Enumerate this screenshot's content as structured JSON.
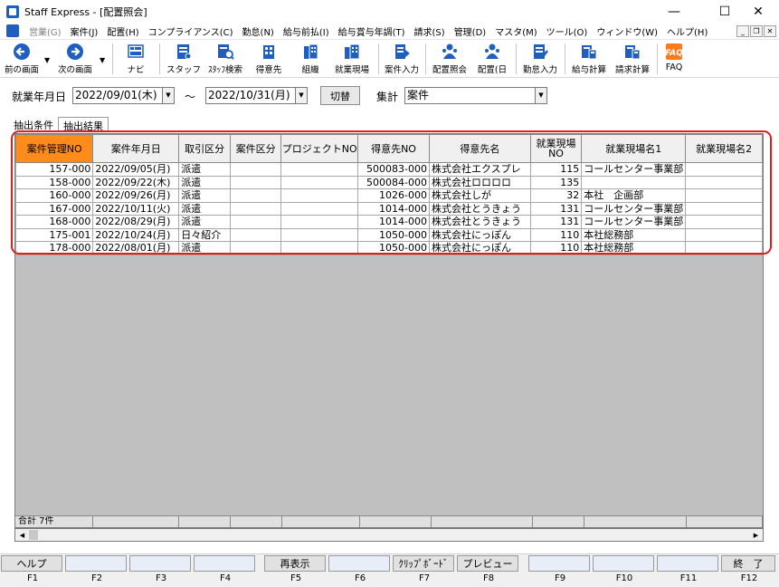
{
  "window": {
    "title": "Staff Express - [配置照会]",
    "controls": {
      "minimize": "—",
      "maximize": "☐",
      "close": "✕"
    }
  },
  "menubar": {
    "items": [
      {
        "label": "営業(G)",
        "disabled": true
      },
      {
        "label": "案件(J)"
      },
      {
        "label": "配置(H)"
      },
      {
        "label": "コンプライアンス(C)"
      },
      {
        "label": "勤怠(N)"
      },
      {
        "label": "給与前払(I)"
      },
      {
        "label": "給与賞与年調(T)"
      },
      {
        "label": "請求(S)"
      },
      {
        "label": "管理(D)"
      },
      {
        "label": "マスタ(M)"
      },
      {
        "label": "ツール(O)"
      },
      {
        "label": "ウィンドウ(W)"
      },
      {
        "label": "ヘルプ(H)"
      }
    ],
    "mdi_controls": {
      "minimize": "_",
      "restore": "❐",
      "close": "✕"
    }
  },
  "toolbar": {
    "buttons": [
      {
        "label": "前の画面",
        "icon": "arrow-left-icon"
      },
      {
        "label": "次の画面",
        "icon": "arrow-right-icon"
      },
      {
        "label": "ナビ",
        "icon": "navi-icon"
      },
      {
        "label": "スタッフ",
        "icon": "staff-icon"
      },
      {
        "label": "ｽﾀｯﾌ検索",
        "icon": "staff-search-icon"
      },
      {
        "label": "得意先",
        "icon": "customer-icon"
      },
      {
        "label": "組織",
        "icon": "organization-icon"
      },
      {
        "label": "就業現場",
        "icon": "worksite-icon"
      },
      {
        "label": "案件入力",
        "icon": "case-entry-icon"
      },
      {
        "label": "配置照会",
        "icon": "placement-inquiry-icon"
      },
      {
        "label": "配置(日",
        "icon": "placement-daily-icon"
      },
      {
        "label": "勤怠入力",
        "icon": "attendance-entry-icon"
      },
      {
        "label": "給与計算",
        "icon": "payroll-icon"
      },
      {
        "label": "請求計算",
        "icon": "billing-icon"
      },
      {
        "label": "FAQ",
        "icon": "faq-icon"
      }
    ]
  },
  "filter": {
    "date_label": "就業年月日",
    "date_from": "2022/09/01(木)",
    "tilde": "～",
    "date_to": "2022/10/31(月)",
    "switch_button": "切替",
    "aggregate_label": "集計",
    "aggregate_value": "案件"
  },
  "tabs": [
    {
      "label": "抽出条件",
      "active": false
    },
    {
      "label": "抽出結果",
      "active": true
    }
  ],
  "grid": {
    "columns": [
      "案件管理NO",
      "案件年月日",
      "取引区分",
      "案件区分",
      "プロジェクトNO",
      "得意先NO",
      "得意先名",
      "就業現場NO",
      "就業現場名1",
      "就業現場名2"
    ],
    "rows": [
      [
        "157-000",
        "2022/09/05(月)",
        "派遣",
        "",
        "",
        "500083-000",
        "株式会社エクスプレ",
        "115",
        "コールセンター事業部",
        ""
      ],
      [
        "158-000",
        "2022/09/22(木)",
        "派遣",
        "",
        "",
        "500084-000",
        "株式会社ロロロロ",
        "135",
        "",
        ""
      ],
      [
        "160-000",
        "2022/09/26(月)",
        "派遣",
        "",
        "",
        "1026-000",
        "株式会社しが",
        "32",
        "本社　企画部",
        ""
      ],
      [
        "167-000",
        "2022/10/11(火)",
        "派遣",
        "",
        "",
        "1014-000",
        "株式会社とうきょう",
        "131",
        "コールセンター事業部",
        ""
      ],
      [
        "168-000",
        "2022/08/29(月)",
        "派遣",
        "",
        "",
        "1014-000",
        "株式会社とうきょう",
        "131",
        "コールセンター事業部",
        ""
      ],
      [
        "175-001",
        "2022/10/24(月)",
        "日々紹介",
        "",
        "",
        "1050-000",
        "株式会社にっぽん",
        "110",
        "本社総務部",
        ""
      ],
      [
        "178-000",
        "2022/08/01(月)",
        "派遣",
        "",
        "",
        "1050-000",
        "株式会社にっぽん",
        "110",
        "本社総務部",
        ""
      ]
    ],
    "total_label": "合計 7件"
  },
  "fkeys": [
    {
      "key": "F1",
      "label": "ヘルプ"
    },
    {
      "key": "F2",
      "label": ""
    },
    {
      "key": "F3",
      "label": ""
    },
    {
      "key": "F4",
      "label": ""
    },
    {
      "key": "F5",
      "label": "再表示"
    },
    {
      "key": "F6",
      "label": ""
    },
    {
      "key": "F7",
      "label": "ｸﾘｯﾌﾟﾎﾞｰﾄﾞ"
    },
    {
      "key": "F8",
      "label": "プレビュー"
    },
    {
      "key": "F9",
      "label": ""
    },
    {
      "key": "F10",
      "label": ""
    },
    {
      "key": "F11",
      "label": ""
    },
    {
      "key": "F12",
      "label": "終　了"
    }
  ],
  "colors": {
    "selected_header": "#ff8c1a",
    "highlight_border": "#e01e1e",
    "grid_background": "#c0c0c0",
    "icon_blue": "#1f5fbf"
  }
}
